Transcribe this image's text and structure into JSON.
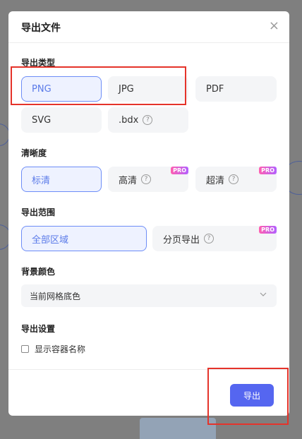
{
  "dialog": {
    "title": "导出文件",
    "close_icon": "×"
  },
  "export_type": {
    "label": "导出类型",
    "options": [
      {
        "label": "PNG",
        "selected": true
      },
      {
        "label": "JPG",
        "selected": false
      },
      {
        "label": "PDF",
        "selected": false
      },
      {
        "label": "SVG",
        "selected": false
      },
      {
        "label": ".bdx",
        "selected": false,
        "help": true
      }
    ]
  },
  "clarity": {
    "label": "清晰度",
    "options": [
      {
        "label": "标清",
        "selected": true
      },
      {
        "label": "高清",
        "selected": false,
        "pro": "PRO",
        "help": true
      },
      {
        "label": "超清",
        "selected": false,
        "pro": "PRO",
        "help": true
      }
    ]
  },
  "export_range": {
    "label": "导出范围",
    "options": [
      {
        "label": "全部区域",
        "selected": true
      },
      {
        "label": "分页导出",
        "selected": false,
        "pro": "PRO",
        "help": true
      }
    ]
  },
  "bg_color": {
    "label": "背景颜色",
    "value": "当前网格底色",
    "chevron_icon": "chevron-down-icon"
  },
  "export_settings": {
    "label": "导出设置",
    "checkbox_label": "显示容器名称",
    "checked": false
  },
  "footer": {
    "export_label": "导出"
  },
  "help_glyph": "?",
  "accent_color": "#5566f0",
  "selected_border_color": "#6d8df7",
  "highlight_color": "#e5332a"
}
